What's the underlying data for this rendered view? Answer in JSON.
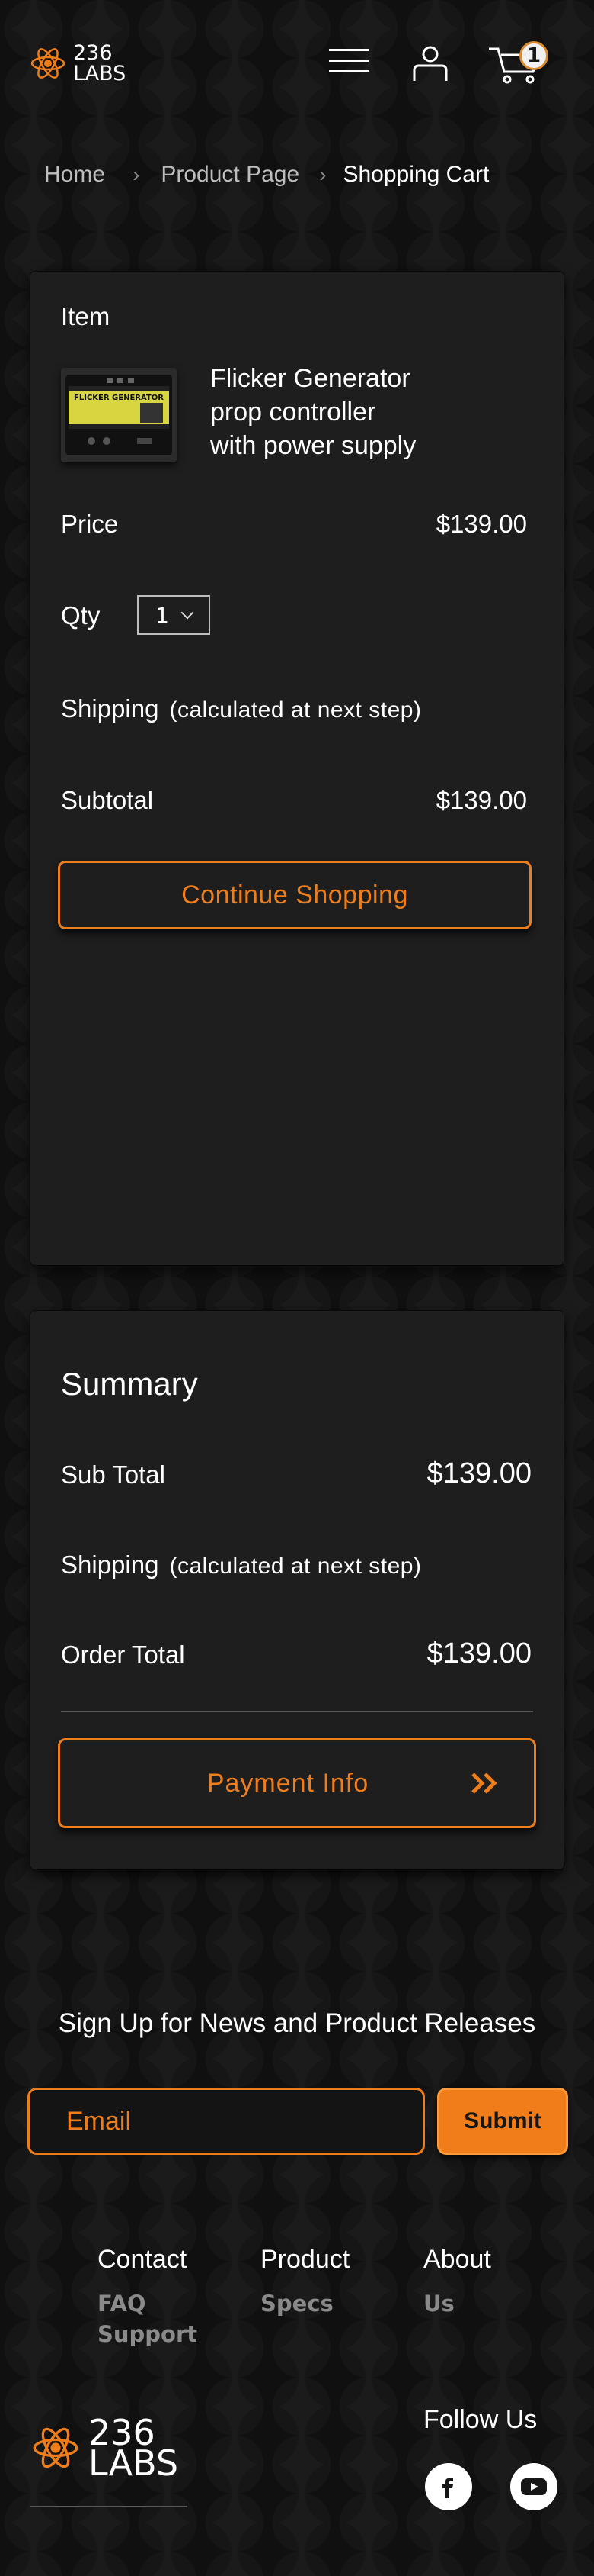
{
  "header": {
    "logo_top": "236",
    "logo_bottom": "LABS",
    "cart_count": "1"
  },
  "breadcrumb": {
    "items": [
      "Home",
      "Product Page"
    ],
    "current": "Shopping Cart"
  },
  "cart": {
    "item_label": "Item",
    "product_name_lines": [
      "Flicker Generator",
      "prop controller",
      "with power supply"
    ],
    "product_image_text": "FLICKER GENERATOR",
    "price_label": "Price",
    "price_value": "$139.00",
    "qty_label": "Qty",
    "qty_value": "1",
    "shipping_label": "Shipping",
    "shipping_note": "(calculated at next step)",
    "subtotal_label": "Subtotal",
    "subtotal_value": "$139.00",
    "continue_label": "Continue Shopping"
  },
  "summary": {
    "title": "Summary",
    "subtotal_label": "Sub Total",
    "subtotal_value": "$139.00",
    "shipping_label": "Shipping",
    "shipping_note": "(calculated at next step)",
    "order_total_label": "Order Total",
    "order_total_value": "$139.00",
    "payment_label": "Payment Info"
  },
  "newsletter": {
    "title": "Sign Up for News and Product Releases",
    "email_placeholder": "Email",
    "submit_label": "Submit"
  },
  "footer": {
    "columns": [
      {
        "heading": "Contact",
        "links": [
          "FAQ",
          "Support"
        ]
      },
      {
        "heading": "Product",
        "links": [
          "Specs"
        ]
      },
      {
        "heading": "About",
        "links": [
          "Us"
        ]
      }
    ],
    "logo_top": "236",
    "logo_bottom": "LABS",
    "follow_label": "Follow Us",
    "social": [
      "facebook-icon",
      "youtube-icon"
    ]
  },
  "colors": {
    "accent": "#ef7d1a",
    "background": "#161616",
    "card": "#1e1e1e"
  }
}
